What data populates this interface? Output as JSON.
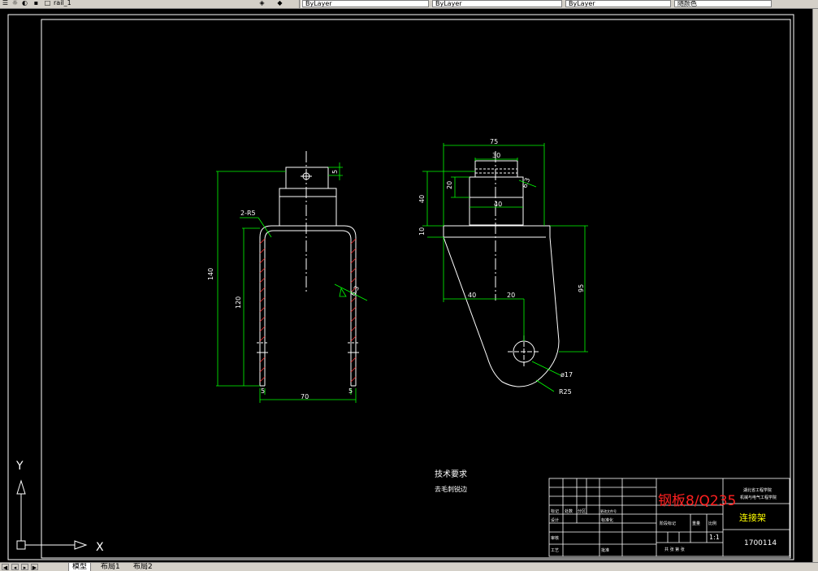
{
  "toolbar": {
    "file_name": "rail_1",
    "layer_boxes": [
      "ByLayer",
      "ByLayer",
      "ByLayer"
    ],
    "color_box": "随颜色"
  },
  "drawing": {
    "dims": {
      "side_total_height": "140",
      "side_leg_height": "120",
      "side_width": "70",
      "side_left_thk": "5",
      "side_right_thk": "5",
      "side_bend_radius": "2-R5",
      "side_top_small": "5",
      "front_top_width": "75",
      "front_hub_width": "30",
      "front_step_width": "40",
      "front_height_40": "40",
      "front_height_20": "20",
      "front_plate_thk": "10",
      "front_left_offset": "40",
      "front_center_offset": "20",
      "front_height_95": "95",
      "front_hole": "ø17",
      "front_radius": "R25",
      "roughness_1": "6.3"
    },
    "notes": {
      "title": "技术要求",
      "line1": "去毛刺锐边"
    },
    "title_block": {
      "material": "钢板8/Q235",
      "school": "湖北省工程学院",
      "department": "机械与电气工程学院",
      "part_name": "连接架",
      "drawing_no": "1700114",
      "scale": "1:1",
      "row_labels": [
        "标记",
        "处数",
        "分区",
        "更改文件号",
        "签名",
        "年月日"
      ],
      "design_label": "设计",
      "standard_label": "标准化",
      "review_label": "审核",
      "process_label": "工艺",
      "approve_label": "批准",
      "stage_label": "阶段标记",
      "weight_label": "重量",
      "scale_label": "比例",
      "sheet_label": "共 张 第 张"
    },
    "ucs": {
      "x_label": "X",
      "y_label": "Y"
    }
  },
  "tabs": {
    "items": [
      "模型",
      "布局1",
      "布局2"
    ]
  },
  "colors": {
    "background": "#000000",
    "geometry": "#ffffff",
    "dimension": "#00ff00",
    "hatch": "#ff3030",
    "material_text": "#ff2020",
    "title_text": "#ffff00"
  }
}
